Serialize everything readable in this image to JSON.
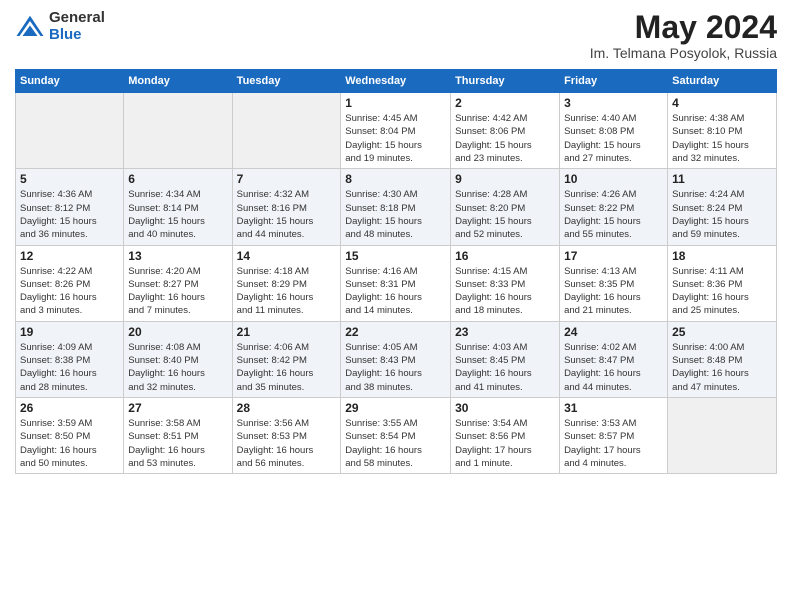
{
  "header": {
    "logo_general": "General",
    "logo_blue": "Blue",
    "title": "May 2024",
    "location": "Im. Telmana Posyolok, Russia"
  },
  "weekdays": [
    "Sunday",
    "Monday",
    "Tuesday",
    "Wednesday",
    "Thursday",
    "Friday",
    "Saturday"
  ],
  "weeks": [
    [
      {
        "day": "",
        "info": ""
      },
      {
        "day": "",
        "info": ""
      },
      {
        "day": "",
        "info": ""
      },
      {
        "day": "1",
        "info": "Sunrise: 4:45 AM\nSunset: 8:04 PM\nDaylight: 15 hours\nand 19 minutes."
      },
      {
        "day": "2",
        "info": "Sunrise: 4:42 AM\nSunset: 8:06 PM\nDaylight: 15 hours\nand 23 minutes."
      },
      {
        "day": "3",
        "info": "Sunrise: 4:40 AM\nSunset: 8:08 PM\nDaylight: 15 hours\nand 27 minutes."
      },
      {
        "day": "4",
        "info": "Sunrise: 4:38 AM\nSunset: 8:10 PM\nDaylight: 15 hours\nand 32 minutes."
      }
    ],
    [
      {
        "day": "5",
        "info": "Sunrise: 4:36 AM\nSunset: 8:12 PM\nDaylight: 15 hours\nand 36 minutes."
      },
      {
        "day": "6",
        "info": "Sunrise: 4:34 AM\nSunset: 8:14 PM\nDaylight: 15 hours\nand 40 minutes."
      },
      {
        "day": "7",
        "info": "Sunrise: 4:32 AM\nSunset: 8:16 PM\nDaylight: 15 hours\nand 44 minutes."
      },
      {
        "day": "8",
        "info": "Sunrise: 4:30 AM\nSunset: 8:18 PM\nDaylight: 15 hours\nand 48 minutes."
      },
      {
        "day": "9",
        "info": "Sunrise: 4:28 AM\nSunset: 8:20 PM\nDaylight: 15 hours\nand 52 minutes."
      },
      {
        "day": "10",
        "info": "Sunrise: 4:26 AM\nSunset: 8:22 PM\nDaylight: 15 hours\nand 55 minutes."
      },
      {
        "day": "11",
        "info": "Sunrise: 4:24 AM\nSunset: 8:24 PM\nDaylight: 15 hours\nand 59 minutes."
      }
    ],
    [
      {
        "day": "12",
        "info": "Sunrise: 4:22 AM\nSunset: 8:26 PM\nDaylight: 16 hours\nand 3 minutes."
      },
      {
        "day": "13",
        "info": "Sunrise: 4:20 AM\nSunset: 8:27 PM\nDaylight: 16 hours\nand 7 minutes."
      },
      {
        "day": "14",
        "info": "Sunrise: 4:18 AM\nSunset: 8:29 PM\nDaylight: 16 hours\nand 11 minutes."
      },
      {
        "day": "15",
        "info": "Sunrise: 4:16 AM\nSunset: 8:31 PM\nDaylight: 16 hours\nand 14 minutes."
      },
      {
        "day": "16",
        "info": "Sunrise: 4:15 AM\nSunset: 8:33 PM\nDaylight: 16 hours\nand 18 minutes."
      },
      {
        "day": "17",
        "info": "Sunrise: 4:13 AM\nSunset: 8:35 PM\nDaylight: 16 hours\nand 21 minutes."
      },
      {
        "day": "18",
        "info": "Sunrise: 4:11 AM\nSunset: 8:36 PM\nDaylight: 16 hours\nand 25 minutes."
      }
    ],
    [
      {
        "day": "19",
        "info": "Sunrise: 4:09 AM\nSunset: 8:38 PM\nDaylight: 16 hours\nand 28 minutes."
      },
      {
        "day": "20",
        "info": "Sunrise: 4:08 AM\nSunset: 8:40 PM\nDaylight: 16 hours\nand 32 minutes."
      },
      {
        "day": "21",
        "info": "Sunrise: 4:06 AM\nSunset: 8:42 PM\nDaylight: 16 hours\nand 35 minutes."
      },
      {
        "day": "22",
        "info": "Sunrise: 4:05 AM\nSunset: 8:43 PM\nDaylight: 16 hours\nand 38 minutes."
      },
      {
        "day": "23",
        "info": "Sunrise: 4:03 AM\nSunset: 8:45 PM\nDaylight: 16 hours\nand 41 minutes."
      },
      {
        "day": "24",
        "info": "Sunrise: 4:02 AM\nSunset: 8:47 PM\nDaylight: 16 hours\nand 44 minutes."
      },
      {
        "day": "25",
        "info": "Sunrise: 4:00 AM\nSunset: 8:48 PM\nDaylight: 16 hours\nand 47 minutes."
      }
    ],
    [
      {
        "day": "26",
        "info": "Sunrise: 3:59 AM\nSunset: 8:50 PM\nDaylight: 16 hours\nand 50 minutes."
      },
      {
        "day": "27",
        "info": "Sunrise: 3:58 AM\nSunset: 8:51 PM\nDaylight: 16 hours\nand 53 minutes."
      },
      {
        "day": "28",
        "info": "Sunrise: 3:56 AM\nSunset: 8:53 PM\nDaylight: 16 hours\nand 56 minutes."
      },
      {
        "day": "29",
        "info": "Sunrise: 3:55 AM\nSunset: 8:54 PM\nDaylight: 16 hours\nand 58 minutes."
      },
      {
        "day": "30",
        "info": "Sunrise: 3:54 AM\nSunset: 8:56 PM\nDaylight: 17 hours\nand 1 minute."
      },
      {
        "day": "31",
        "info": "Sunrise: 3:53 AM\nSunset: 8:57 PM\nDaylight: 17 hours\nand 4 minutes."
      },
      {
        "day": "",
        "info": ""
      }
    ]
  ]
}
